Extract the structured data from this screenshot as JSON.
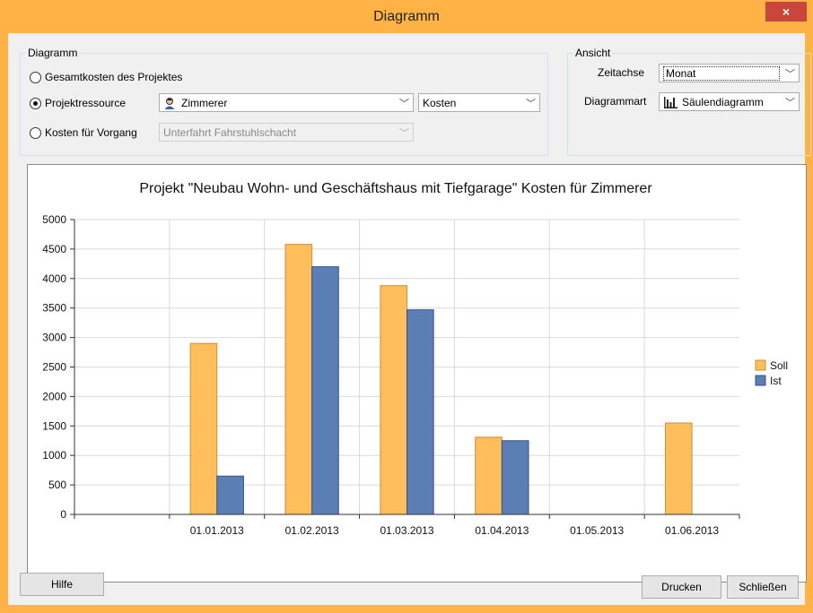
{
  "window": {
    "title": "Diagramm",
    "close_glyph": "×"
  },
  "diagramm_group": {
    "label": "Diagramm",
    "radio_total": "Gesamtkosten des Projektes",
    "radio_resource": "Projektressource",
    "radio_task": "Kosten für Vorgang",
    "resource_value": "Zimmerer",
    "resource_icon": "person-icon",
    "kind_value": "Kosten",
    "task_value": "Unterfahrt Fahrstuhlschacht"
  },
  "ansicht_group": {
    "label": "Ansicht",
    "zeitachse_label": "Zeitachse",
    "zeitachse_value": "Monat",
    "diagrammart_label": "Diagrammart",
    "diagrammart_value": "Säulendiagramm",
    "diagrammart_icon": "bar-chart-icon"
  },
  "buttons": {
    "help": "Hilfe",
    "print": "Drucken",
    "close": "Schließen"
  },
  "colors": {
    "titlebar": "#ffb347",
    "soll": "#ffbe5c",
    "ist": "#5b7fb5"
  },
  "chart_data": {
    "type": "bar",
    "title": "Projekt \"Neubau Wohn- und Geschäftshaus mit Tiefgarage\" Kosten für Zimmerer",
    "categories": [
      "",
      "01.01.2013",
      "01.02.2013",
      "01.03.2013",
      "01.04.2013",
      "01.05.2013",
      "01.06.2013"
    ],
    "series": [
      {
        "name": "Soll",
        "values": [
          0,
          2900,
          4580,
          3880,
          1310,
          0,
          1550
        ]
      },
      {
        "name": "Ist",
        "values": [
          0,
          650,
          4200,
          3470,
          1250,
          0,
          0
        ]
      }
    ],
    "ylim": [
      0,
      5000
    ],
    "yticks": [
      0,
      500,
      1000,
      1500,
      2000,
      2500,
      3000,
      3500,
      4000,
      4500,
      5000
    ],
    "grid": true,
    "legend": "right"
  }
}
